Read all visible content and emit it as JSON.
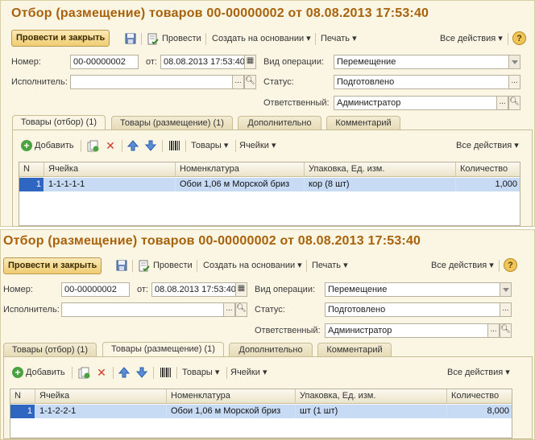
{
  "windows": [
    {
      "title": "Отбор (размещение) товаров 00-00000002 от 08.08.2013 17:53:40",
      "toolbar": {
        "post_close": "Провести и закрыть",
        "post": "Провести",
        "create_based": "Создать на основании",
        "print": "Печать",
        "all_actions": "Все действия",
        "help": "?"
      },
      "form": {
        "number_label": "Номер:",
        "number_value": "00-00000002",
        "date_label": "от:",
        "date_value": "08.08.2013 17:53:40",
        "executor_label": "Исполнитель:",
        "executor_value": "",
        "operation_label": "Вид операции:",
        "operation_value": "Перемещение",
        "status_label": "Статус:",
        "status_value": "Подготовлено",
        "responsible_label": "Ответственный:",
        "responsible_value": "Администратор"
      },
      "tabs": [
        "Товары (отбор) (1)",
        "Товары (размещение) (1)",
        "Дополнительно",
        "Комментарий"
      ],
      "active_tab": 0,
      "table_toolbar": {
        "add": "Добавить",
        "goods": "Товары",
        "cells": "Ячейки",
        "all_actions": "Все действия"
      },
      "table": {
        "columns": [
          "N",
          "Ячейка",
          "Номенклатура",
          "Упаковка, Ед. изм.",
          "Количество"
        ],
        "rows": [
          [
            "1",
            "1-1-1-1-1",
            "Обои 1,06 м Морской бриз",
            "кор (8 шт)",
            "1,000"
          ]
        ]
      }
    },
    {
      "title": "Отбор (размещение) товаров 00-00000002 от 08.08.2013 17:53:40",
      "toolbar": {
        "post_close": "Провести и закрыть",
        "post": "Провести",
        "create_based": "Создать на основании",
        "print": "Печать",
        "all_actions": "Все действия",
        "help": "?"
      },
      "form": {
        "number_label": "Номер:",
        "number_value": "00-00000002",
        "date_label": "от:",
        "date_value": "08.08.2013 17:53:40",
        "executor_label": "Исполнитель:",
        "executor_value": "",
        "operation_label": "Вид операции:",
        "operation_value": "Перемещение",
        "status_label": "Статус:",
        "status_value": "Подготовлено",
        "responsible_label": "Ответственный:",
        "responsible_value": "Администратор"
      },
      "tabs": [
        "Товары (отбор) (1)",
        "Товары (размещение) (1)",
        "Дополнительно",
        "Комментарий"
      ],
      "active_tab": 1,
      "table_toolbar": {
        "add": "Добавить",
        "goods": "Товары",
        "cells": "Ячейки",
        "all_actions": "Все действия"
      },
      "table": {
        "columns": [
          "N",
          "Ячейка",
          "Номенклатура",
          "Упаковка, Ед. изм.",
          "Количество"
        ],
        "rows": [
          [
            "1",
            "1-1-2-2-1",
            "Обои 1,06 м Морской бриз",
            "шт (1 шт)",
            "8,000"
          ]
        ]
      }
    }
  ],
  "colors": {
    "title": "#a8620a",
    "panel_bg": "#fbf5e4",
    "selected_row": "#c7dbf5",
    "row_number_bg": "#2f66c2"
  }
}
